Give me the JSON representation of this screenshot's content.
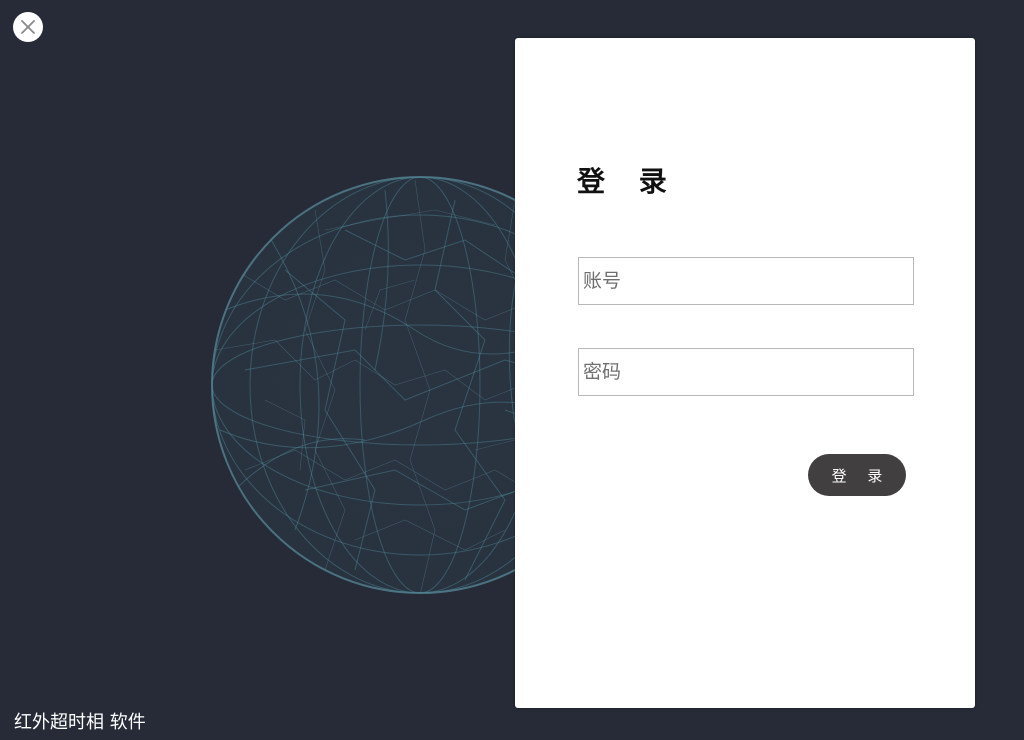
{
  "window": {
    "close_icon": "close-icon",
    "background_color": "#262b37"
  },
  "login": {
    "title": "登 录",
    "account_placeholder": "账号",
    "password_placeholder": "密码",
    "submit_label": "登 录",
    "button_color": "#413f3f"
  },
  "footer": {
    "app_name": "红外超时相 软件"
  }
}
